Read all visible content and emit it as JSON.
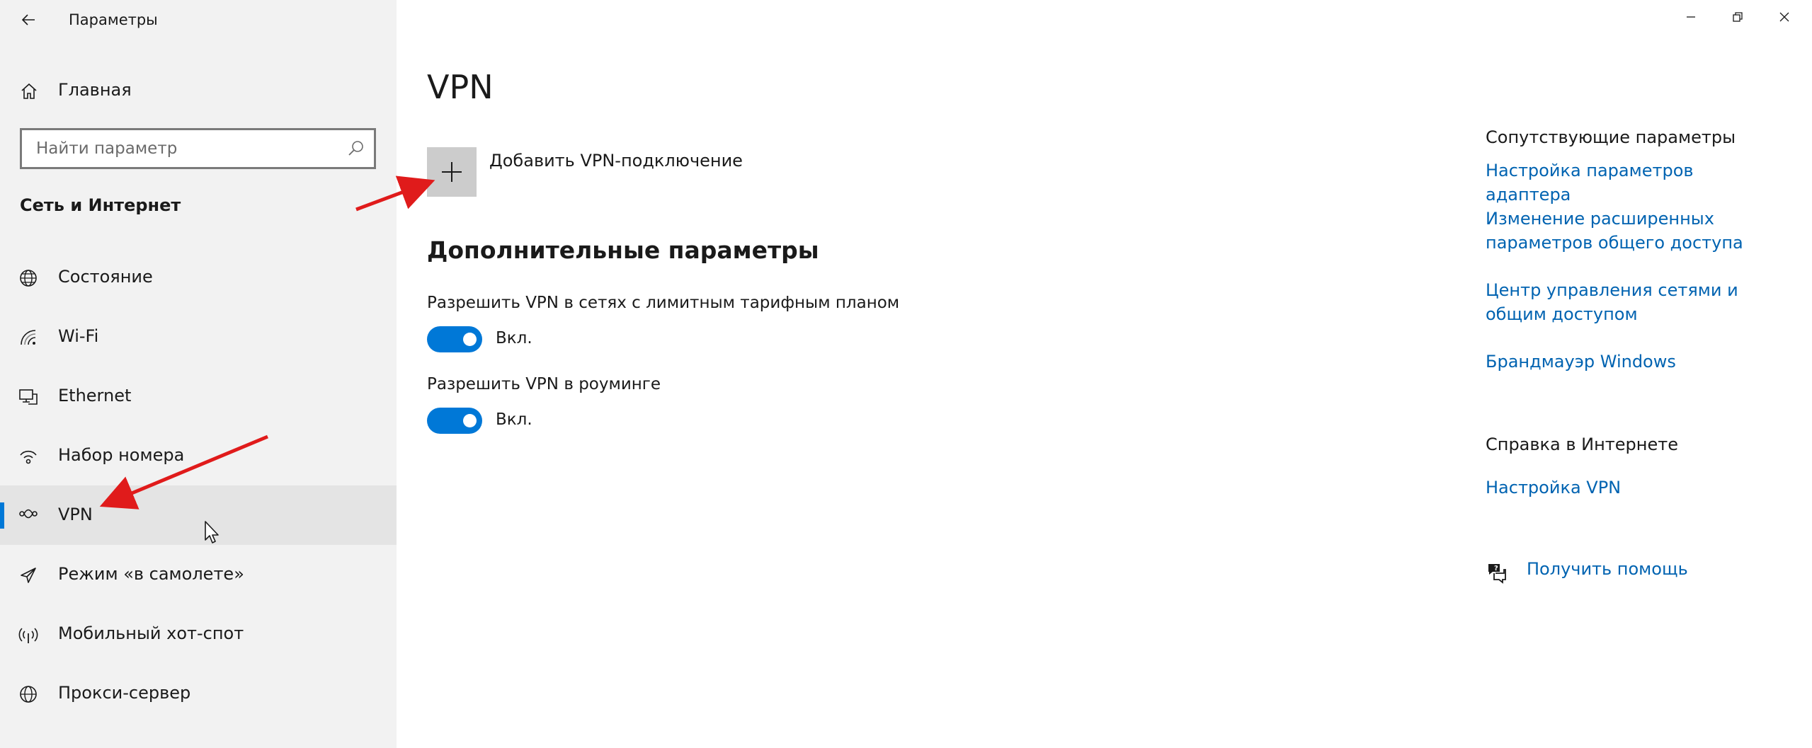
{
  "window": {
    "title": "Параметры"
  },
  "sidebar": {
    "home_label": "Главная",
    "search_placeholder": "Найти параметр",
    "section_title": "Сеть и Интернет",
    "items": [
      {
        "label": "Состояние",
        "icon": "globe-status-icon"
      },
      {
        "label": "Wi-Fi",
        "icon": "wifi-icon"
      },
      {
        "label": "Ethernet",
        "icon": "ethernet-icon"
      },
      {
        "label": "Набор номера",
        "icon": "dialup-icon"
      },
      {
        "label": "VPN",
        "icon": "vpn-icon",
        "selected": true
      },
      {
        "label": "Режим «в самолете»",
        "icon": "airplane-icon"
      },
      {
        "label": "Мобильный хот-спот",
        "icon": "hotspot-icon"
      },
      {
        "label": "Прокси-сервер",
        "icon": "globe-icon"
      }
    ]
  },
  "main": {
    "title": "VPN",
    "add_vpn_label": "Добавить VPN-подключение",
    "advanced_title": "Дополнительные параметры",
    "settings": [
      {
        "label": "Разрешить VPN в сетях с лимитным тарифным планом",
        "state": "Вкл.",
        "on": true
      },
      {
        "label": "Разрешить VPN в роуминге",
        "state": "Вкл.",
        "on": true
      }
    ]
  },
  "related": {
    "heading": "Сопутствующие параметры",
    "links": [
      "Настройка параметров адаптера",
      "Изменение расширенных параметров общего доступа",
      "Центр управления сетями и общим доступом",
      "Брандмауэр Windows"
    ]
  },
  "online_help": {
    "heading": "Справка в Интернете",
    "links": [
      "Настройка VPN"
    ],
    "get_help_label": "Получить помощь"
  },
  "colors": {
    "accent": "#0078d7",
    "link": "#0063b1",
    "sidebar_bg": "#f2f2f2",
    "annotation_arrow": "#e01b1b"
  }
}
